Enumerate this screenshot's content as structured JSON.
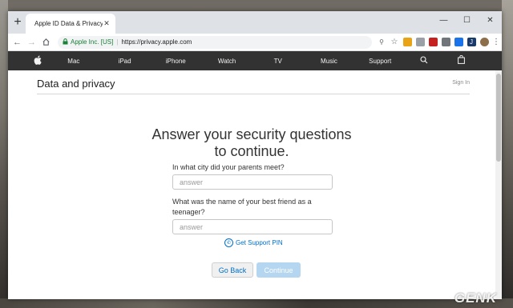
{
  "browser": {
    "tab_title": "Apple ID Data & Privacy",
    "new_tab": "+",
    "tab_close": "✕",
    "window_controls": {
      "minimize": "—",
      "maximize": "☐",
      "close": "✕"
    },
    "address": {
      "ev_org": "Apple Inc. [US]",
      "url": "https://privacy.apple.com"
    }
  },
  "apple_nav": {
    "items": [
      "Mac",
      "iPad",
      "iPhone",
      "Watch",
      "TV",
      "Music",
      "Support"
    ]
  },
  "page": {
    "title": "Data and privacy",
    "sign_in": "Sign In",
    "heading_line1": "Answer your security questions",
    "heading_line2": "to continue.",
    "question1": "In what city did your parents meet?",
    "answer1_placeholder": "answer",
    "question2": "What was the name of your best friend as a teenager?",
    "answer2_placeholder": "answer",
    "support_pin": "Get Support PIN",
    "go_back": "Go Back",
    "continue": "Continue"
  },
  "watermark": "GENK",
  "colors": {
    "apple_nav_bg": "#323232",
    "link_blue": "#0070c9",
    "continue_disabled": "#b5d6f0",
    "secure_green": "#188038"
  }
}
